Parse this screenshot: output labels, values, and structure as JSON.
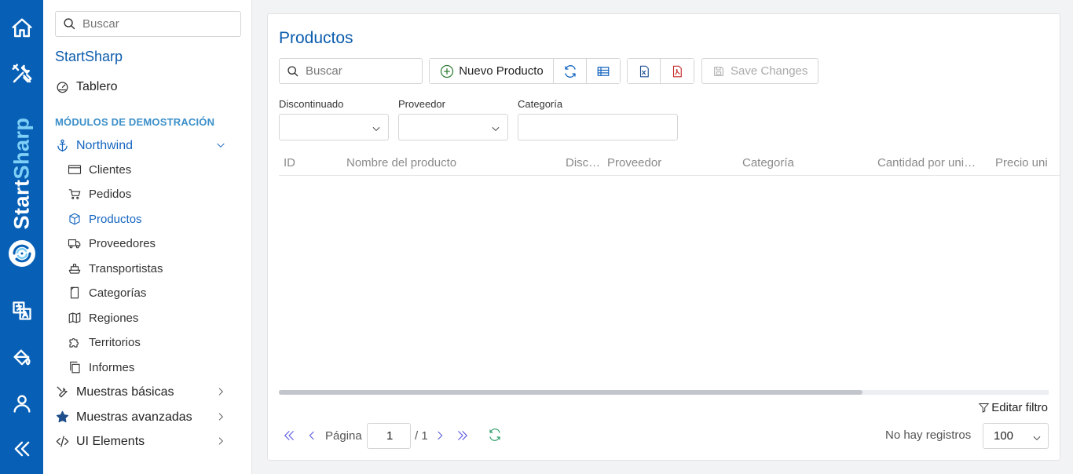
{
  "rail": {
    "brand_part1": "Start",
    "brand_part2": "Sharp",
    "icons": [
      "home-icon",
      "tools-icon",
      "translate-icon",
      "paint-bucket-icon",
      "user-icon",
      "collapse-icon"
    ]
  },
  "sidebar": {
    "search_placeholder": "Buscar",
    "app_title": "StartSharp",
    "dashboard_label": "Tablero",
    "section_label": "MÓDULOS DE DEMOSTRACIÓN",
    "group_label": "Northwind",
    "items": [
      {
        "label": "Clientes",
        "icon": "card-icon"
      },
      {
        "label": "Pedidos",
        "icon": "cart-icon"
      },
      {
        "label": "Productos",
        "icon": "box-icon",
        "active": true
      },
      {
        "label": "Proveedores",
        "icon": "truck-icon"
      },
      {
        "label": "Transportistas",
        "icon": "ship-icon"
      },
      {
        "label": "Categorías",
        "icon": "page-icon"
      },
      {
        "label": "Regiones",
        "icon": "map-icon"
      },
      {
        "label": "Territorios",
        "icon": "puzzle-icon"
      },
      {
        "label": "Informes",
        "icon": "copy-icon"
      }
    ],
    "more": [
      {
        "label": "Muestras básicas",
        "icon": "wrench-icon"
      },
      {
        "label": "Muestras avanzadas",
        "icon": "star-icon"
      },
      {
        "label": "UI Elements",
        "icon": "code-icon"
      }
    ]
  },
  "page": {
    "title": "Productos",
    "search_placeholder": "Buscar",
    "new_button": "Nuevo Producto",
    "save_button": "Save Changes",
    "filters": {
      "discontinued_label": "Discontinuado",
      "supplier_label": "Proveedor",
      "category_label": "Categoría"
    },
    "columns": [
      "ID",
      "Nombre del producto",
      "Disc…",
      "Proveedor",
      "Categoría",
      "Cantidad por uni…",
      "Precio uni"
    ],
    "edit_filter": "Editar filtro",
    "pager": {
      "page_label": "Página",
      "page_value": "1",
      "total": "/ 1",
      "no_records": "No hay registros",
      "page_size": "100"
    }
  },
  "colors": {
    "rail": "#0760b6",
    "brand_accent": "#7fd0f6",
    "title": "#0a5cad",
    "section": "#3b8fc9",
    "pager_icons": "#5a5adf"
  }
}
